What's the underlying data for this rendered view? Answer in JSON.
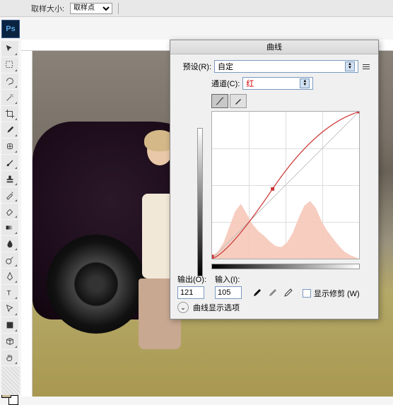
{
  "topbar": {
    "sample_label": "取样大小:",
    "sample_value": "取样点"
  },
  "ps_icon": "Ps",
  "tools": [
    {
      "name": "move"
    },
    {
      "name": "marquee"
    },
    {
      "name": "lasso"
    },
    {
      "name": "magic-wand"
    },
    {
      "name": "crop"
    },
    {
      "name": "eyedropper"
    },
    {
      "name": "healing"
    },
    {
      "name": "brush"
    },
    {
      "name": "stamp"
    },
    {
      "name": "history-brush"
    },
    {
      "name": "eraser"
    },
    {
      "name": "gradient"
    },
    {
      "name": "blur"
    },
    {
      "name": "dodge"
    },
    {
      "name": "pen"
    },
    {
      "name": "type"
    },
    {
      "name": "path-select"
    },
    {
      "name": "shape"
    },
    {
      "name": "3d"
    },
    {
      "name": "hand"
    },
    {
      "name": "zoom"
    }
  ],
  "curves": {
    "title": "曲线",
    "preset_label": "预设(R):",
    "preset_value": "自定",
    "channel_label": "通道(C):",
    "channel_value": "红",
    "output_label": "输出(O):",
    "output_value": "121",
    "input_label": "输入(I):",
    "input_value": "105",
    "show_clip_label": "显示修剪 (W)",
    "options_label": "曲线显示选项"
  },
  "chart_data": {
    "type": "area",
    "title": "",
    "xlabel": "",
    "ylabel": "",
    "xlim": [
      0,
      255
    ],
    "ylim": [
      0,
      255
    ],
    "curve_points": [
      {
        "x": 0,
        "y": 0
      },
      {
        "x": 30,
        "y": 10
      },
      {
        "x": 105,
        "y": 121
      },
      {
        "x": 200,
        "y": 220
      },
      {
        "x": 255,
        "y": 255
      }
    ],
    "histogram": [
      {
        "x": 0,
        "h": 5
      },
      {
        "x": 10,
        "h": 12
      },
      {
        "x": 20,
        "h": 28
      },
      {
        "x": 30,
        "h": 55
      },
      {
        "x": 40,
        "h": 82
      },
      {
        "x": 50,
        "h": 95
      },
      {
        "x": 60,
        "h": 78
      },
      {
        "x": 70,
        "h": 60
      },
      {
        "x": 80,
        "h": 48
      },
      {
        "x": 90,
        "h": 40
      },
      {
        "x": 100,
        "h": 30
      },
      {
        "x": 110,
        "h": 22
      },
      {
        "x": 120,
        "h": 20
      },
      {
        "x": 130,
        "h": 28
      },
      {
        "x": 140,
        "h": 45
      },
      {
        "x": 150,
        "h": 70
      },
      {
        "x": 160,
        "h": 92
      },
      {
        "x": 170,
        "h": 100
      },
      {
        "x": 180,
        "h": 88
      },
      {
        "x": 190,
        "h": 65
      },
      {
        "x": 200,
        "h": 48
      },
      {
        "x": 210,
        "h": 35
      },
      {
        "x": 220,
        "h": 22
      },
      {
        "x": 230,
        "h": 12
      },
      {
        "x": 240,
        "h": 6
      },
      {
        "x": 250,
        "h": 2
      }
    ]
  }
}
